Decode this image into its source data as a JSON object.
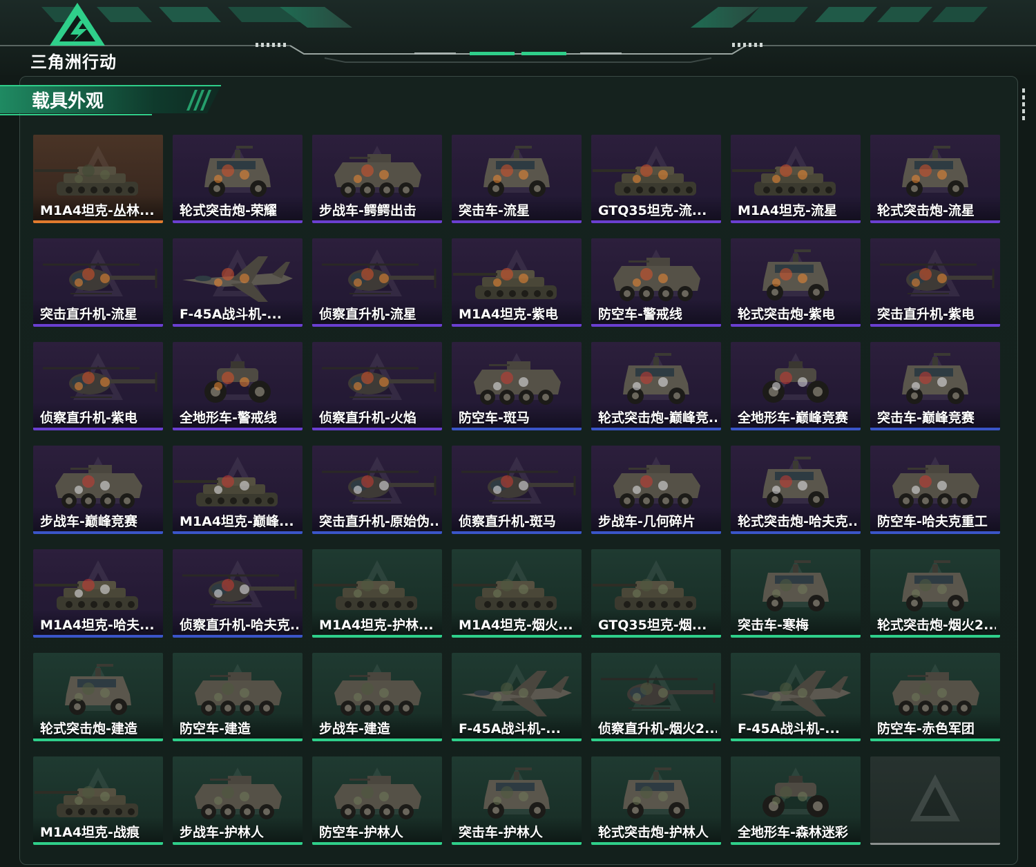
{
  "app": {
    "logo_text": "三角洲行动"
  },
  "section": {
    "title": "载具外观"
  },
  "colors": {
    "purple": "#6a3fd0",
    "green": "#2fcf8a",
    "orange": "#e07a2e",
    "blue": "#3a55c8",
    "gray": "#8a8f8d"
  },
  "items": [
    {
      "label": "M1A4坦克-丛林...",
      "theme": "orange",
      "type": "tank"
    },
    {
      "label": "轮式突击炮-荣耀",
      "theme": "purple",
      "type": "car"
    },
    {
      "label": "步战车-鳄鳄出击",
      "theme": "purple",
      "type": "apc"
    },
    {
      "label": "突击车-流星",
      "theme": "purple",
      "type": "car"
    },
    {
      "label": "GTQ35坦克-流...",
      "theme": "purple",
      "type": "tank"
    },
    {
      "label": "M1A4坦克-流星",
      "theme": "purple",
      "type": "tank"
    },
    {
      "label": "轮式突击炮-流星",
      "theme": "purple",
      "type": "car"
    },
    {
      "label": "突击直升机-流星",
      "theme": "purple",
      "type": "heli"
    },
    {
      "label": "F-45A战斗机-...",
      "theme": "purple",
      "type": "jet"
    },
    {
      "label": "侦察直升机-流星",
      "theme": "purple",
      "type": "heli"
    },
    {
      "label": "M1A4坦克-紫电",
      "theme": "purple",
      "type": "tank"
    },
    {
      "label": "防空车-警戒线",
      "theme": "purple",
      "type": "apc"
    },
    {
      "label": "轮式突击炮-紫电",
      "theme": "purple",
      "type": "car"
    },
    {
      "label": "突击直升机-紫电",
      "theme": "purple",
      "type": "heli"
    },
    {
      "label": "侦察直升机-紫电",
      "theme": "purple",
      "type": "heli"
    },
    {
      "label": "全地形车-警戒线",
      "theme": "purple",
      "type": "atv"
    },
    {
      "label": "侦察直升机-火焰",
      "theme": "purple",
      "type": "heli"
    },
    {
      "label": "防空车-斑马",
      "theme": "blue",
      "type": "apc"
    },
    {
      "label": "轮式突击炮-巅峰竞...",
      "theme": "blue",
      "type": "car"
    },
    {
      "label": "全地形车-巅峰竞赛",
      "theme": "blue",
      "type": "atv"
    },
    {
      "label": "突击车-巅峰竞赛",
      "theme": "blue",
      "type": "car"
    },
    {
      "label": "步战车-巅峰竞赛",
      "theme": "blue",
      "type": "apc"
    },
    {
      "label": "M1A4坦克-巅峰...",
      "theme": "blue",
      "type": "tank"
    },
    {
      "label": "突击直升机-原始伪...",
      "theme": "blue",
      "type": "heli"
    },
    {
      "label": "侦察直升机-斑马",
      "theme": "blue",
      "type": "heli"
    },
    {
      "label": "步战车-几何碎片",
      "theme": "blue",
      "type": "apc"
    },
    {
      "label": "轮式突击炮-哈夫克...",
      "theme": "blue",
      "type": "car"
    },
    {
      "label": "防空车-哈夫克重工",
      "theme": "blue",
      "type": "apc"
    },
    {
      "label": "M1A4坦克-哈夫...",
      "theme": "blue",
      "type": "tank"
    },
    {
      "label": "侦察直升机-哈夫克...",
      "theme": "blue",
      "type": "heli"
    },
    {
      "label": "M1A4坦克-护林...",
      "theme": "green",
      "type": "tank"
    },
    {
      "label": "M1A4坦克-烟火...",
      "theme": "green",
      "type": "tank"
    },
    {
      "label": "GTQ35坦克-烟...",
      "theme": "green",
      "type": "tank"
    },
    {
      "label": "突击车-寒梅",
      "theme": "green",
      "type": "car"
    },
    {
      "label": "轮式突击炮-烟火2...",
      "theme": "green",
      "type": "car"
    },
    {
      "label": "轮式突击炮-建造",
      "theme": "green",
      "type": "car"
    },
    {
      "label": "防空车-建造",
      "theme": "green",
      "type": "apc"
    },
    {
      "label": "步战车-建造",
      "theme": "green",
      "type": "apc"
    },
    {
      "label": "F-45A战斗机-...",
      "theme": "green",
      "type": "jet"
    },
    {
      "label": "侦察直升机-烟火2...",
      "theme": "green",
      "type": "heli"
    },
    {
      "label": "F-45A战斗机-...",
      "theme": "green",
      "type": "jet"
    },
    {
      "label": "防空车-赤色军团",
      "theme": "green",
      "type": "apc"
    },
    {
      "label": "M1A4坦克-战痕",
      "theme": "green",
      "type": "tank"
    },
    {
      "label": "步战车-护林人",
      "theme": "green",
      "type": "apc"
    },
    {
      "label": "防空车-护林人",
      "theme": "green",
      "type": "apc"
    },
    {
      "label": "突击车-护林人",
      "theme": "green",
      "type": "car"
    },
    {
      "label": "轮式突击炮-护林人",
      "theme": "green",
      "type": "car"
    },
    {
      "label": "全地形车-森林迷彩",
      "theme": "green",
      "type": "atv"
    },
    {
      "label": "",
      "theme": "empty",
      "type": "none"
    }
  ]
}
